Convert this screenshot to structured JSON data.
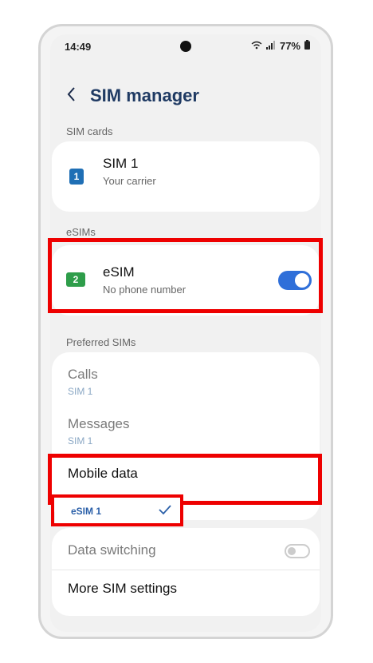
{
  "status": {
    "time": "14:49",
    "battery": "77%"
  },
  "header": {
    "title": "SIM manager"
  },
  "sections": {
    "sim_cards": "SIM cards",
    "esims": "eSIMs",
    "preferred": "Preferred SIMs"
  },
  "sim1": {
    "badge": "1",
    "name": "SIM 1",
    "carrier": "Your carrier"
  },
  "esim": {
    "badge": "2",
    "name": "eSIM",
    "number": "No phone number",
    "enabled": true
  },
  "preferred": {
    "calls": {
      "label": "Calls",
      "value": "SIM 1"
    },
    "messages": {
      "label": "Messages",
      "value": "SIM 1"
    },
    "mobile_data": {
      "label": "Mobile data",
      "value": "eSIM 1"
    }
  },
  "data_switching": {
    "label": "Data switching",
    "enabled": false
  },
  "more": {
    "label": "More SIM settings"
  },
  "colors": {
    "accent": "#2f6fd9",
    "highlight": "#ee0000",
    "sim1_icon": "#1f6fb5",
    "esim_icon": "#2e9d4a"
  }
}
